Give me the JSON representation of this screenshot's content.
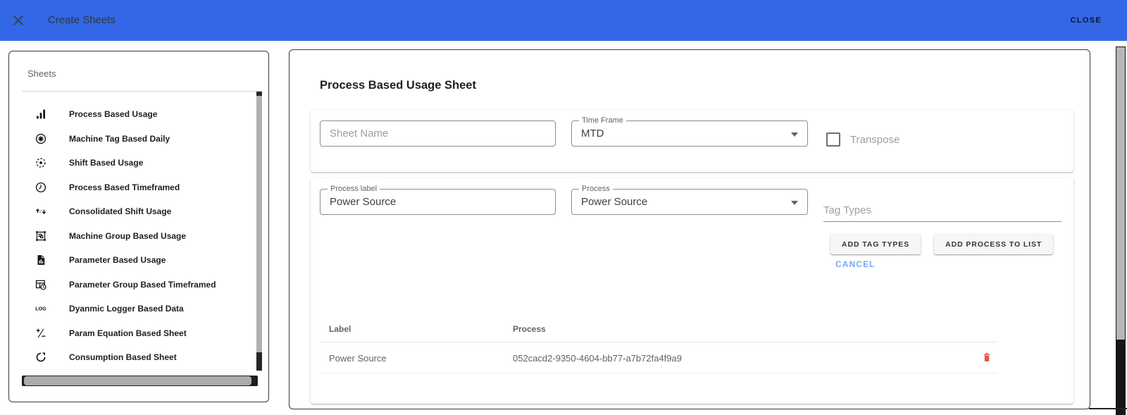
{
  "header": {
    "title": "Create Sheets",
    "close_label": "CLOSE"
  },
  "sidebar": {
    "title": "Sheets",
    "items": [
      {
        "label": "Process Based Usage",
        "icon": "bar-chart"
      },
      {
        "label": "Machine Tag Based Daily",
        "icon": "gear-circle"
      },
      {
        "label": "Shift Based Usage",
        "icon": "target-dotted"
      },
      {
        "label": "Process Based Timeframed",
        "icon": "clock"
      },
      {
        "label": "Consolidated Shift Usage",
        "icon": "swap-arrows"
      },
      {
        "label": "Machine Group Based Usage",
        "icon": "group-box"
      },
      {
        "label": "Parameter Based Usage",
        "icon": "file-chart"
      },
      {
        "label": "Parameter Group Based Timeframed",
        "icon": "table-clock"
      },
      {
        "label": "Dyanmic Logger Based Data",
        "icon": "log-text"
      },
      {
        "label": "Param Equation Based Sheet",
        "icon": "plus-minus"
      },
      {
        "label": "Consumption Based Sheet",
        "icon": "loop"
      }
    ]
  },
  "main": {
    "title": "Process Based Usage Sheet",
    "sheet_name": {
      "placeholder": "Sheet Name",
      "value": ""
    },
    "time_frame": {
      "label": "Time Frame",
      "value": "MTD"
    },
    "transpose": {
      "label": "Transpose",
      "checked": false
    },
    "process_label_field": {
      "label": "Process label",
      "value": "Power Source"
    },
    "process_select": {
      "label": "Process",
      "value": "Power Source"
    },
    "tag_types": {
      "placeholder": "Tag Types",
      "value": ""
    },
    "buttons": {
      "add_tag_types": "ADD TAG TYPES",
      "add_process_to_list": "ADD PROCESS TO LIST",
      "cancel": "CANCEL"
    },
    "table": {
      "columns": [
        "Label",
        "Process"
      ],
      "rows": [
        {
          "label": "Power Source",
          "process": "052cacd2-9350-4604-bb77-a7b72fa4f9a9"
        }
      ]
    }
  },
  "colors": {
    "appbar_blue": "#3367E5",
    "cancel_link": "#74A8F7",
    "delete_red": "#E8524A"
  }
}
